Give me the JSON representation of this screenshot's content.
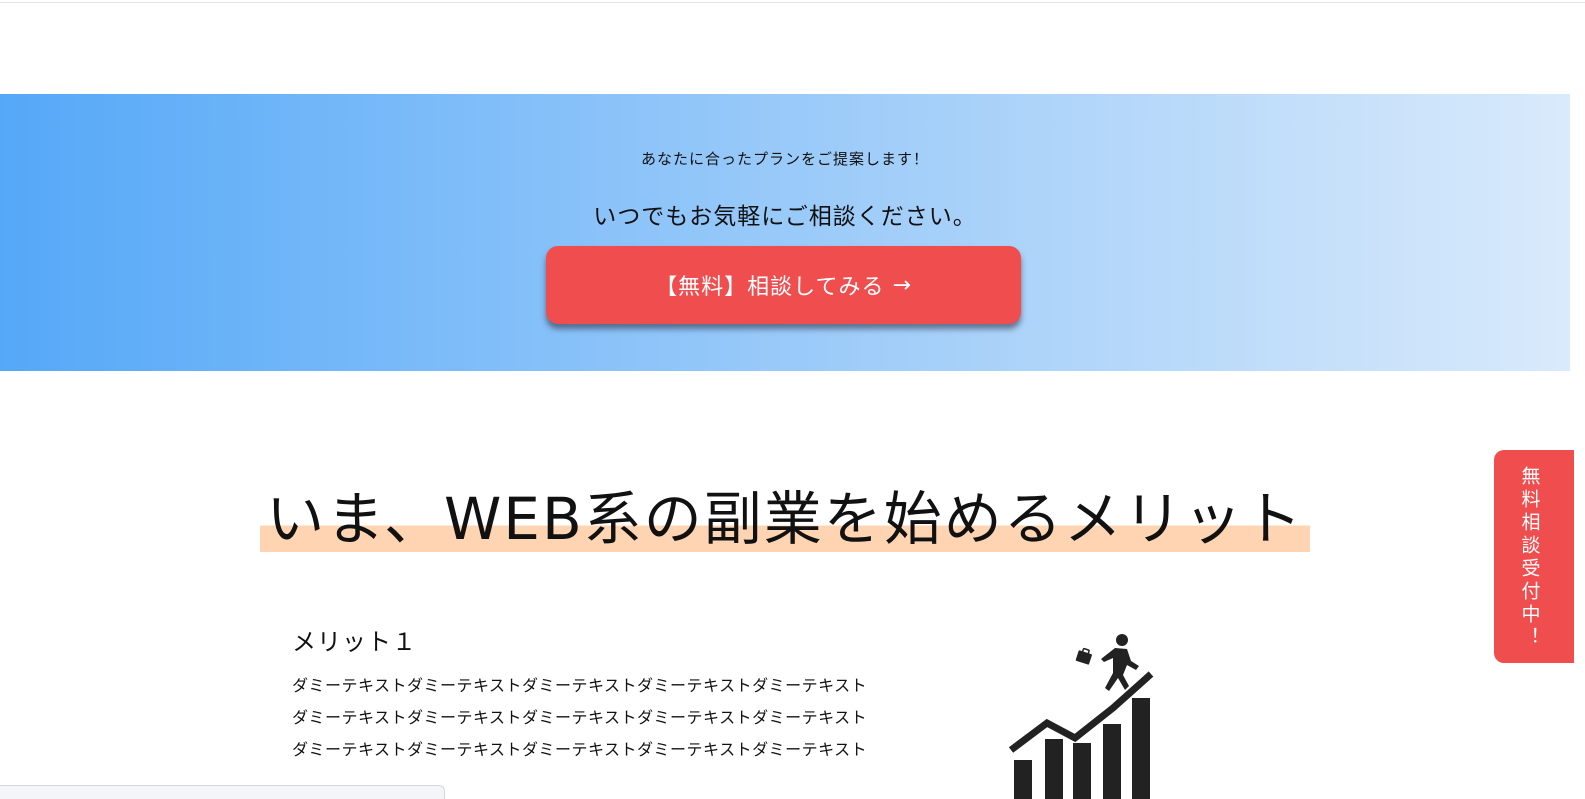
{
  "cta": {
    "subtext": "あなたに合ったプランをご提案します！",
    "main_text": "いつでもお気軽にご相談ください。",
    "button_label": "【無料】相談してみる",
    "button_arrow": "→",
    "gradient_colors": [
      "#55a8f8",
      "#d9eafb"
    ],
    "button_color": "#f04d4f"
  },
  "merits": {
    "heading": "いま、WEB系の副業を始めるメリット",
    "highlight_color": "#ffd4b3",
    "items": [
      {
        "title": "メリット１",
        "lines": [
          "ダミーテキストダミーテキストダミーテキストダミーテキストダミーテキスト",
          "ダミーテキストダミーテキストダミーテキストダミーテキストダミーテキスト",
          "ダミーテキストダミーテキストダミーテキストダミーテキストダミーテキスト"
        ],
        "icon": "business-growth-icon"
      }
    ]
  },
  "side_tab": {
    "label": "無料相談受付中！",
    "color": "#f04d4f"
  }
}
